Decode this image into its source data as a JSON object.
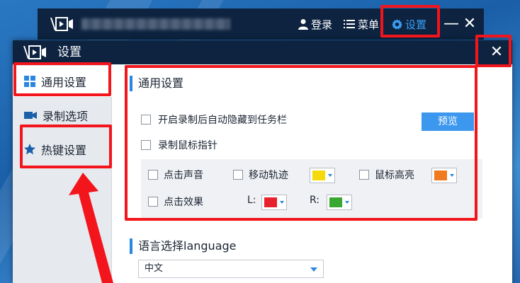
{
  "main_window": {
    "title": "",
    "login_label": "登录",
    "menu_label": "菜单",
    "settings_label": "设置",
    "minimize_glyph": "—",
    "close_glyph": "✕"
  },
  "dialog": {
    "title": "设置",
    "close_glyph": "✕",
    "sidebar": {
      "items": [
        {
          "label": "通用设置",
          "icon": "grid-icon"
        },
        {
          "label": "录制选项",
          "icon": "video-camera-icon"
        },
        {
          "label": "热键设置",
          "icon": "star-icon"
        }
      ]
    },
    "general": {
      "section_title": "通用设置",
      "option_auto_hide": "开启录制后自动隐藏到任务栏",
      "option_record_cursor": "录制鼠标指针",
      "preview_label": "预览",
      "cursor_options": {
        "click_sound": "点击声音",
        "move_track": "移动轨迹",
        "cursor_highlight": "鼠标高亮",
        "click_effect": "点击效果",
        "left_label": "L:",
        "right_label": "R:"
      }
    },
    "language": {
      "section_title": "语言选择language",
      "selected": "中文"
    }
  },
  "colors": {
    "titlebar": "#0d2340",
    "accent_blue": "#2b86e0",
    "annotation_red": "#f2151c",
    "track_color": "#f5d90a",
    "highlight_color": "#f07a1e",
    "left_click_color": "#e8222c",
    "right_click_color": "#38a832"
  }
}
